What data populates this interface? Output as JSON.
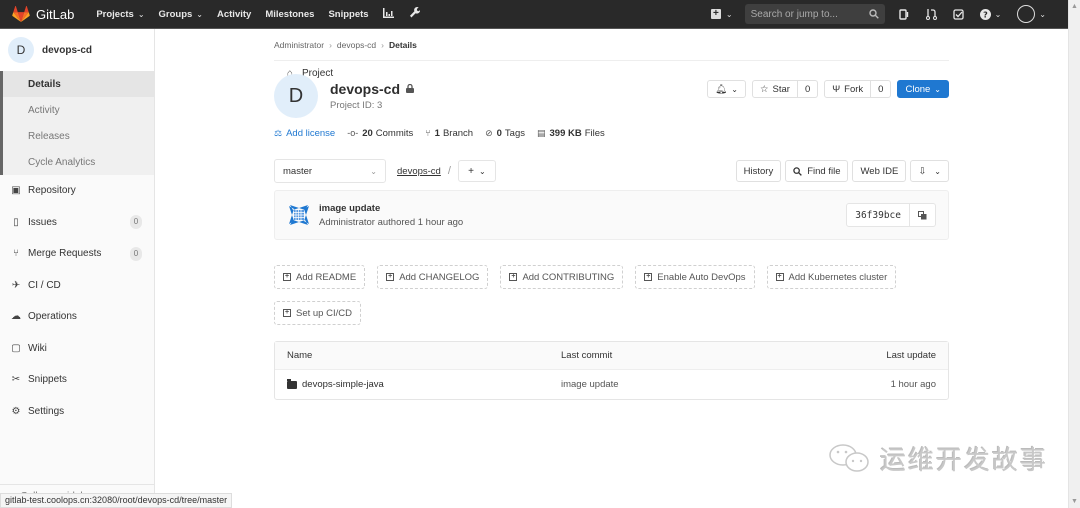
{
  "topbar": {
    "brand": "GitLab",
    "nav": [
      {
        "label": "Projects",
        "dropdown": true
      },
      {
        "label": "Groups",
        "dropdown": true
      },
      {
        "label": "Activity",
        "dropdown": false
      },
      {
        "label": "Milestones",
        "dropdown": false
      },
      {
        "label": "Snippets",
        "dropdown": false
      }
    ],
    "nav_icons": [
      "chart-icon",
      "wrench-icon"
    ],
    "search_placeholder": "Search or jump to...",
    "right_icons": [
      "issues-icon",
      "merge-request-icon",
      "todo-icon",
      "help-icon",
      "avatar"
    ]
  },
  "sidebar": {
    "project_initial": "D",
    "project_name": "devops-cd",
    "section_label": "Project",
    "sub_items": [
      {
        "label": "Details",
        "active": true
      },
      {
        "label": "Activity",
        "active": false
      },
      {
        "label": "Releases",
        "active": false
      },
      {
        "label": "Cycle Analytics",
        "active": false
      }
    ],
    "items": [
      {
        "label": "Repository",
        "icon": "repository-icon",
        "badge": null
      },
      {
        "label": "Issues",
        "icon": "issues-icon",
        "badge": "0"
      },
      {
        "label": "Merge Requests",
        "icon": "merge-request-icon",
        "badge": "0"
      },
      {
        "label": "CI / CD",
        "icon": "rocket-icon",
        "badge": null
      },
      {
        "label": "Operations",
        "icon": "cloud-gear-icon",
        "badge": null
      },
      {
        "label": "Wiki",
        "icon": "book-icon",
        "badge": null
      },
      {
        "label": "Snippets",
        "icon": "scissors-icon",
        "badge": null
      },
      {
        "label": "Settings",
        "icon": "gear-icon",
        "badge": null
      }
    ],
    "collapse_label": "Collapse sidebar"
  },
  "status_url": "gitlab-test.coolops.cn:32080/root/devops-cd/tree/master",
  "breadcrumb": [
    "Administrator",
    "devops-cd",
    "Details"
  ],
  "project": {
    "initial": "D",
    "name": "devops-cd",
    "id_label": "Project ID: 3",
    "star_label": "Star",
    "star_count": "0",
    "fork_label": "Fork",
    "fork_count": "0",
    "clone_label": "Clone"
  },
  "stats": {
    "add_license": "Add license",
    "commits_count": "20",
    "commits_label": "Commits",
    "branch_count": "1",
    "branch_label": "Branch",
    "tags_count": "0",
    "tags_label": "Tags",
    "files_size": "399 KB",
    "files_label": "Files"
  },
  "tree": {
    "branch": "master",
    "path": "devops-cd",
    "history_label": "History",
    "find_file_label": "Find file",
    "web_ide_label": "Web IDE"
  },
  "commit": {
    "title": "image update",
    "meta": "Administrator authored 1 hour ago",
    "sha": "36f39bce"
  },
  "quick_actions": [
    "Add README",
    "Add CHANGELOG",
    "Add CONTRIBUTING",
    "Enable Auto DevOps",
    "Add Kubernetes cluster",
    "Set up CI/CD"
  ],
  "files": {
    "headers": [
      "Name",
      "Last commit",
      "Last update"
    ],
    "rows": [
      {
        "name": "devops-simple-java",
        "type": "folder",
        "last_commit": "image update",
        "last_update": "1 hour ago"
      }
    ]
  },
  "watermark": "运维开发故事",
  "colors": {
    "topbar_bg": "#292929",
    "accent": "#1f78d1",
    "sidebar_bg": "#fafafa"
  }
}
